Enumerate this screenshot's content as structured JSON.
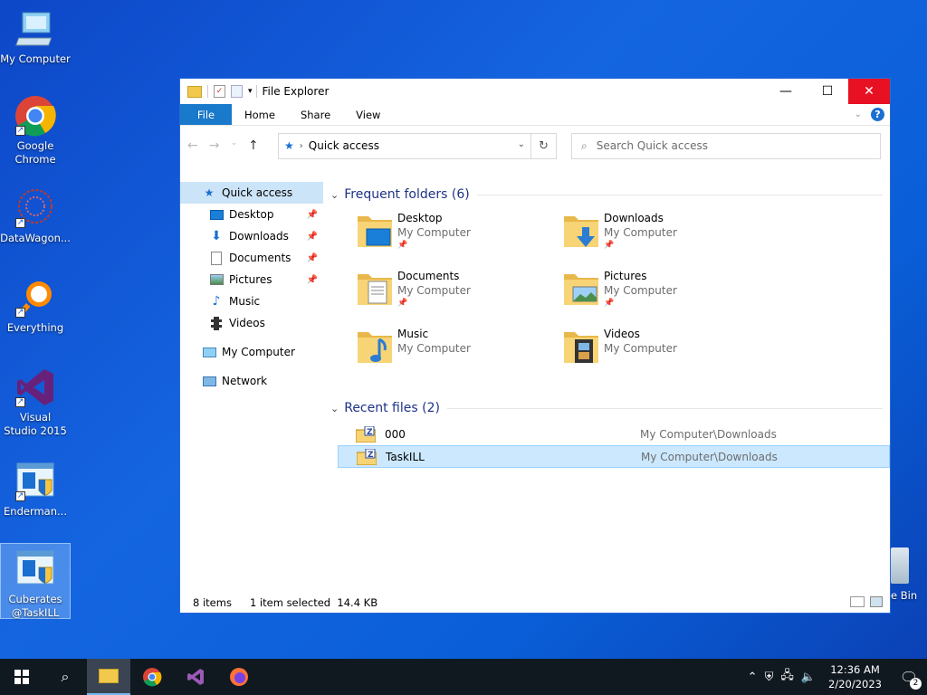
{
  "desktop": {
    "icons": [
      {
        "label": "My Computer"
      },
      {
        "label": "Google Chrome"
      },
      {
        "label": "DataWagon..."
      },
      {
        "label": "Everything"
      },
      {
        "label": "Visual Studio 2015"
      },
      {
        "label": "Enderman..."
      },
      {
        "label": "Cuberates@TaskILL"
      }
    ],
    "recycle_label": "e Bin"
  },
  "window": {
    "title": "File Explorer",
    "ribbon_tabs": [
      "File",
      "Home",
      "Share",
      "View"
    ],
    "address": "Quick access",
    "search_placeholder": "Search Quick access"
  },
  "sidebar": {
    "items": [
      {
        "label": "Quick access"
      },
      {
        "label": "Desktop"
      },
      {
        "label": "Downloads"
      },
      {
        "label": "Documents"
      },
      {
        "label": "Pictures"
      },
      {
        "label": "Music"
      },
      {
        "label": "Videos"
      },
      {
        "label": "My Computer"
      },
      {
        "label": "Network"
      }
    ]
  },
  "frequent": {
    "header": "Frequent folders (6)",
    "folders": [
      {
        "name": "Desktop",
        "location": "My Computer"
      },
      {
        "name": "Downloads",
        "location": "My Computer"
      },
      {
        "name": "Documents",
        "location": "My Computer"
      },
      {
        "name": "Pictures",
        "location": "My Computer"
      },
      {
        "name": "Music",
        "location": "My Computer"
      },
      {
        "name": "Videos",
        "location": "My Computer"
      }
    ]
  },
  "recent": {
    "header": "Recent files (2)",
    "files": [
      {
        "name": "000",
        "location": "My Computer\\Downloads"
      },
      {
        "name": "TaskILL",
        "location": "My Computer\\Downloads"
      }
    ]
  },
  "status": {
    "items": "8 items",
    "selected": "1 item selected",
    "size": "14.4 KB"
  },
  "taskbar": {
    "time": "12:36 AM",
    "date": "2/20/2023",
    "notifications": "2"
  },
  "colors": {
    "accent": "#1979ca",
    "close": "#e81123",
    "selection": "#cce8ff",
    "header_text": "#1e3287"
  }
}
